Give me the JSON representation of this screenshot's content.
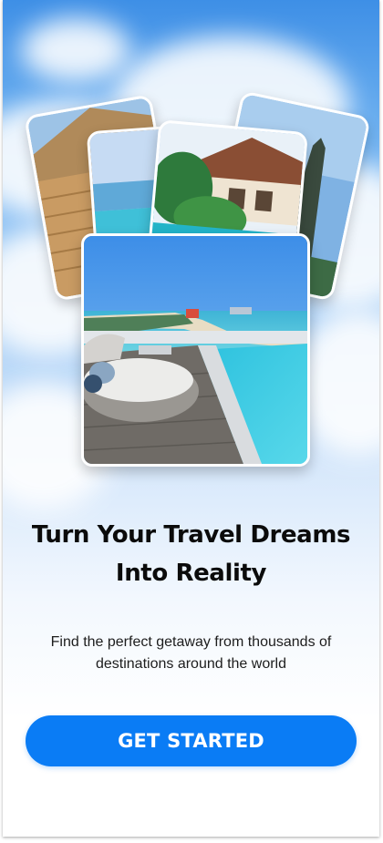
{
  "onboarding": {
    "headline_line1": "Turn Your Travel Dreams",
    "headline_line2": "Into Reality",
    "subtitle_line1": "Find the perfect getaway from thousands of",
    "subtitle_line2": "destinations around the world",
    "cta_label": "GET STARTED"
  },
  "colors": {
    "accent": "#0a7cf5",
    "sky_top": "#3e8fe6",
    "text": "#0b0b0b"
  }
}
